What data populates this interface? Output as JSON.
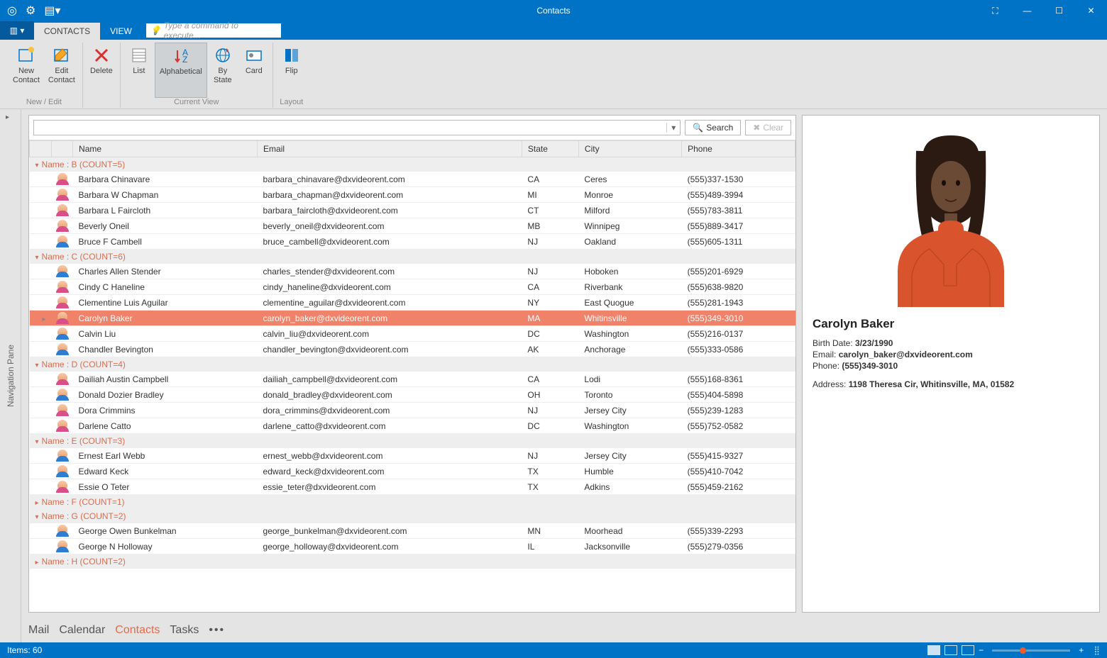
{
  "window": {
    "title": "Contacts"
  },
  "tabs": {
    "contacts": "CONTACTS",
    "view": "VIEW",
    "command_placeholder": "Type a command to execute..."
  },
  "ribbon": {
    "new_edit": {
      "new_contact": "New\nContact",
      "edit_contact": "Edit\nContact",
      "label": "New / Edit"
    },
    "delete": {
      "delete": "Delete"
    },
    "current_view": {
      "list": "List",
      "alphabetical": "Alphabetical",
      "by_state": "By\nState",
      "card": "Card",
      "label": "Current View"
    },
    "layout": {
      "flip": "Flip",
      "label": "Layout"
    }
  },
  "nav_pane_label": "Navigation Pane",
  "search": {
    "search_btn": "Search",
    "clear_btn": "Clear"
  },
  "columns": {
    "name": "Name",
    "email": "Email",
    "state": "State",
    "city": "City",
    "phone": "Phone"
  },
  "groups": [
    {
      "label": "Name : B (COUNT=5)",
      "expanded": true,
      "rows": [
        {
          "g": "f",
          "name": "Barbara Chinavare",
          "email": "barbara_chinavare@dxvideorent.com",
          "state": "CA",
          "city": "Ceres",
          "phone": "(555)337-1530"
        },
        {
          "g": "f",
          "name": "Barbara W Chapman",
          "email": "barbara_chapman@dxvideorent.com",
          "state": "MI",
          "city": "Monroe",
          "phone": "(555)489-3994"
        },
        {
          "g": "f",
          "name": "Barbara L Faircloth",
          "email": "barbara_faircloth@dxvideorent.com",
          "state": "CT",
          "city": "Milford",
          "phone": "(555)783-3811"
        },
        {
          "g": "f",
          "name": "Beverly Oneil",
          "email": "beverly_oneil@dxvideorent.com",
          "state": "MB",
          "city": "Winnipeg",
          "phone": "(555)889-3417"
        },
        {
          "g": "m",
          "name": "Bruce F Cambell",
          "email": "bruce_cambell@dxvideorent.com",
          "state": "NJ",
          "city": "Oakland",
          "phone": "(555)605-1311"
        }
      ]
    },
    {
      "label": "Name : C (COUNT=6)",
      "expanded": true,
      "rows": [
        {
          "g": "m",
          "name": "Charles Allen Stender",
          "email": "charles_stender@dxvideorent.com",
          "state": "NJ",
          "city": "Hoboken",
          "phone": "(555)201-6929"
        },
        {
          "g": "f",
          "name": "Cindy C Haneline",
          "email": "cindy_haneline@dxvideorent.com",
          "state": "CA",
          "city": "Riverbank",
          "phone": "(555)638-9820"
        },
        {
          "g": "f",
          "name": "Clementine Luis Aguilar",
          "email": "clementine_aguilar@dxvideorent.com",
          "state": "NY",
          "city": "East Quogue",
          "phone": "(555)281-1943"
        },
        {
          "g": "f",
          "name": "Carolyn Baker",
          "email": "carolyn_baker@dxvideorent.com",
          "state": "MA",
          "city": "Whitinsville",
          "phone": "(555)349-3010",
          "selected": true
        },
        {
          "g": "m",
          "name": "Calvin Liu",
          "email": "calvin_liu@dxvideorent.com",
          "state": "DC",
          "city": "Washington",
          "phone": "(555)216-0137"
        },
        {
          "g": "m",
          "name": "Chandler Bevington",
          "email": "chandler_bevington@dxvideorent.com",
          "state": "AK",
          "city": "Anchorage",
          "phone": "(555)333-0586"
        }
      ]
    },
    {
      "label": "Name : D (COUNT=4)",
      "expanded": true,
      "rows": [
        {
          "g": "f",
          "name": "Dailiah Austin Campbell",
          "email": "dailiah_campbell@dxvideorent.com",
          "state": "CA",
          "city": "Lodi",
          "phone": "(555)168-8361"
        },
        {
          "g": "m",
          "name": "Donald Dozier Bradley",
          "email": "donald_bradley@dxvideorent.com",
          "state": "OH",
          "city": "Toronto",
          "phone": "(555)404-5898"
        },
        {
          "g": "f",
          "name": "Dora Crimmins",
          "email": "dora_crimmins@dxvideorent.com",
          "state": "NJ",
          "city": "Jersey City",
          "phone": "(555)239-1283"
        },
        {
          "g": "f",
          "name": "Darlene Catto",
          "email": "darlene_catto@dxvideorent.com",
          "state": "DC",
          "city": "Washington",
          "phone": "(555)752-0582"
        }
      ]
    },
    {
      "label": "Name : E (COUNT=3)",
      "expanded": true,
      "rows": [
        {
          "g": "m",
          "name": "Ernest Earl Webb",
          "email": "ernest_webb@dxvideorent.com",
          "state": "NJ",
          "city": "Jersey City",
          "phone": "(555)415-9327"
        },
        {
          "g": "m",
          "name": "Edward Keck",
          "email": "edward_keck@dxvideorent.com",
          "state": "TX",
          "city": "Humble",
          "phone": "(555)410-7042"
        },
        {
          "g": "f",
          "name": "Essie O Teter",
          "email": "essie_teter@dxvideorent.com",
          "state": "TX",
          "city": "Adkins",
          "phone": "(555)459-2162"
        }
      ]
    },
    {
      "label": "Name : F (COUNT=1)",
      "expanded": false,
      "rows": []
    },
    {
      "label": "Name : G (COUNT=2)",
      "expanded": true,
      "rows": [
        {
          "g": "m",
          "name": "George Owen Bunkelman",
          "email": "george_bunkelman@dxvideorent.com",
          "state": "MN",
          "city": "Moorhead",
          "phone": "(555)339-2293"
        },
        {
          "g": "m",
          "name": "George N Holloway",
          "email": "george_holloway@dxvideorent.com",
          "state": "IL",
          "city": "Jacksonville",
          "phone": "(555)279-0356"
        }
      ]
    },
    {
      "label": "Name : H (COUNT=2)",
      "expanded": false,
      "rows": []
    }
  ],
  "detail": {
    "name": "Carolyn Baker",
    "birth_label": "Birth Date:",
    "birth": "3/23/1990",
    "email_label": "Email:",
    "email": "carolyn_baker@dxvideorent.com",
    "phone_label": "Phone:",
    "phone": "(555)349-3010",
    "address_label": "Address:",
    "address": "1198 Theresa Cir, Whitinsville, MA, 01582"
  },
  "footer_nav": {
    "mail": "Mail",
    "calendar": "Calendar",
    "contacts": "Contacts",
    "tasks": "Tasks"
  },
  "status": {
    "items": "Items: 60"
  }
}
